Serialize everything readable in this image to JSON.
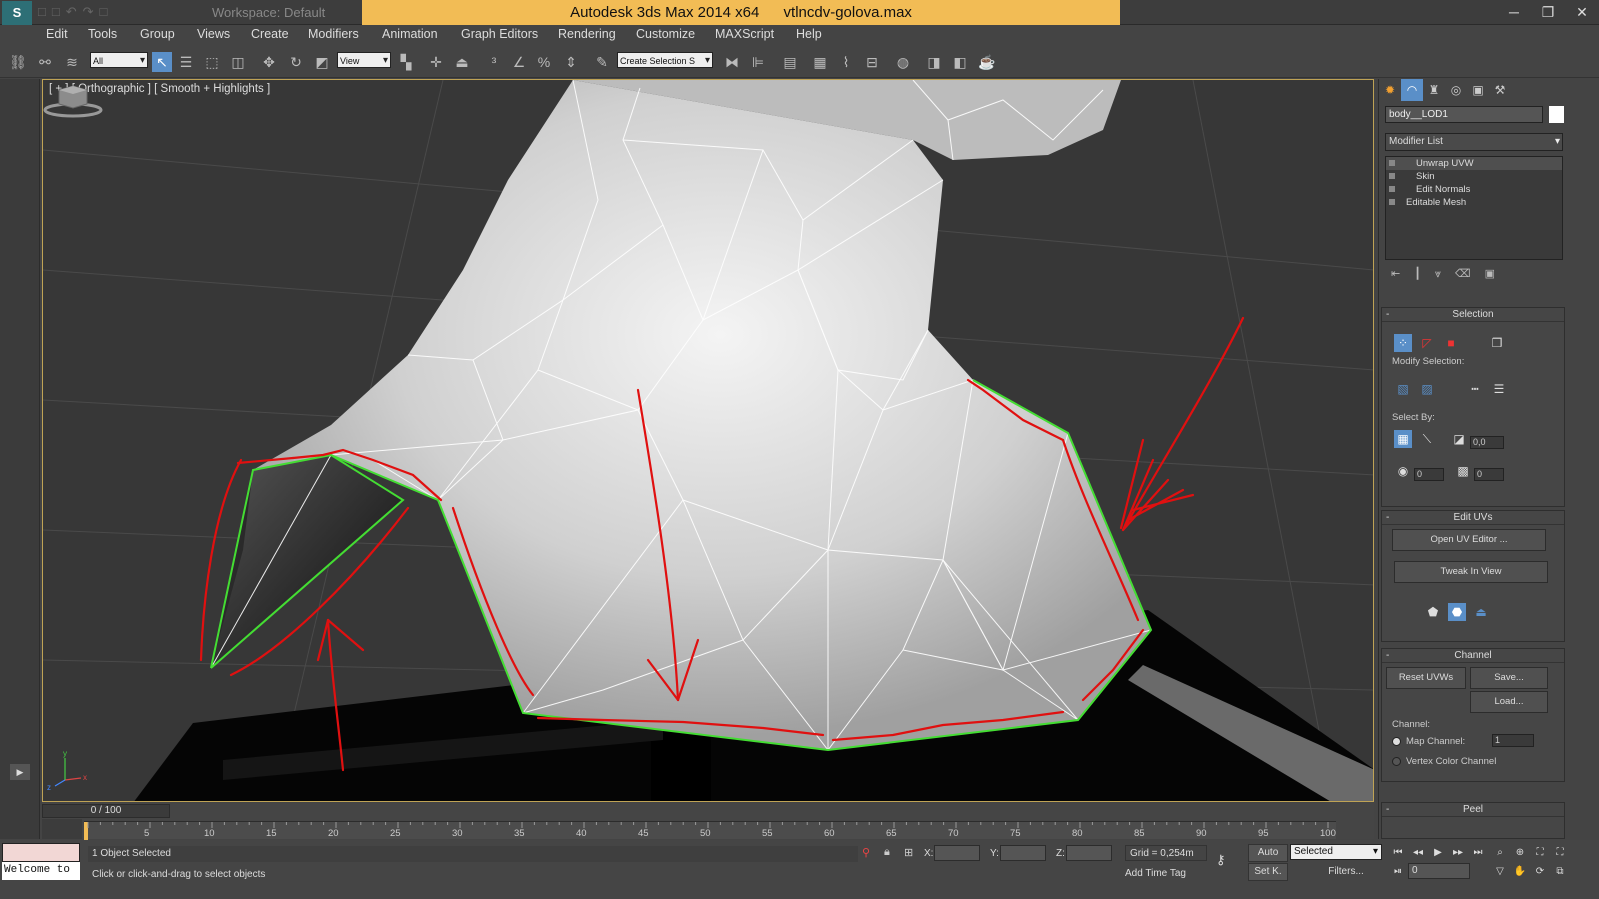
{
  "app": {
    "logo_text": "S",
    "workspace": "Workspace: Default",
    "title": "Autodesk 3ds Max  2014 x64",
    "filename": "vtlncdv-golova.max"
  },
  "window_controls": {
    "minimize": "─",
    "maximize": "❐",
    "close": "✕"
  },
  "menu": [
    "Edit",
    "Tools",
    "Group",
    "Views",
    "Create",
    "Modifiers",
    "Animation",
    "Graph Editors",
    "Rendering",
    "Customize",
    "MAXScript",
    "Help"
  ],
  "toolbar": {
    "filter_select": "All",
    "ref_coord": "View",
    "named_selection": "Create Selection S"
  },
  "viewport": {
    "label": "[ + ] [ Orthographic ] [ Smooth + Highlights ]",
    "axis_x": "x",
    "axis_y": "y",
    "axis_z": "z"
  },
  "command_panel": {
    "object_name": "body__LOD1",
    "modifier_list": "Modifier List",
    "stack": [
      "Unwrap UVW",
      "Skin",
      "Edit Normals",
      "Editable Mesh"
    ],
    "selection": {
      "title": "Selection",
      "modify_selection": "Modify Selection:",
      "select_by": "Select By:",
      "angle": "0,0",
      "val1": "0",
      "val2": "0"
    },
    "edit_uvs": {
      "title": "Edit UVs",
      "open_editor": "Open UV Editor ...",
      "tweak": "Tweak In View"
    },
    "channel": {
      "title": "Channel",
      "reset": "Reset UVWs",
      "save": "Save...",
      "load": "Load...",
      "group_label": "Channel:",
      "map_channel": "Map Channel:",
      "map_channel_value": "1",
      "vertex_color": "Vertex Color Channel"
    },
    "peel": {
      "title": "Peel"
    }
  },
  "timeline": {
    "slider": "0 / 100",
    "ticks": [
      "5",
      "10",
      "15",
      "20",
      "25",
      "30",
      "35",
      "40",
      "45",
      "50",
      "55",
      "60",
      "65",
      "70",
      "75",
      "80",
      "85",
      "90",
      "95",
      "100"
    ]
  },
  "status": {
    "welcome": "Welcome to",
    "selected_count": "1 Object Selected",
    "prompt": "Click or click-and-drag to select objects",
    "x_label": "X:",
    "y_label": "Y:",
    "z_label": "Z:",
    "grid": "Grid = 0,254m",
    "add_time_tag": "Add Time Tag",
    "auto": "Auto",
    "set_key": "Set K.",
    "key_filter": "Selected",
    "filters": "Filters...",
    "frame": "0"
  },
  "colors": {
    "title_highlight": "#f2bc55",
    "selection_edge": "#44dd33",
    "annotation": "#e01010",
    "viewport_border": "#bfa355"
  }
}
